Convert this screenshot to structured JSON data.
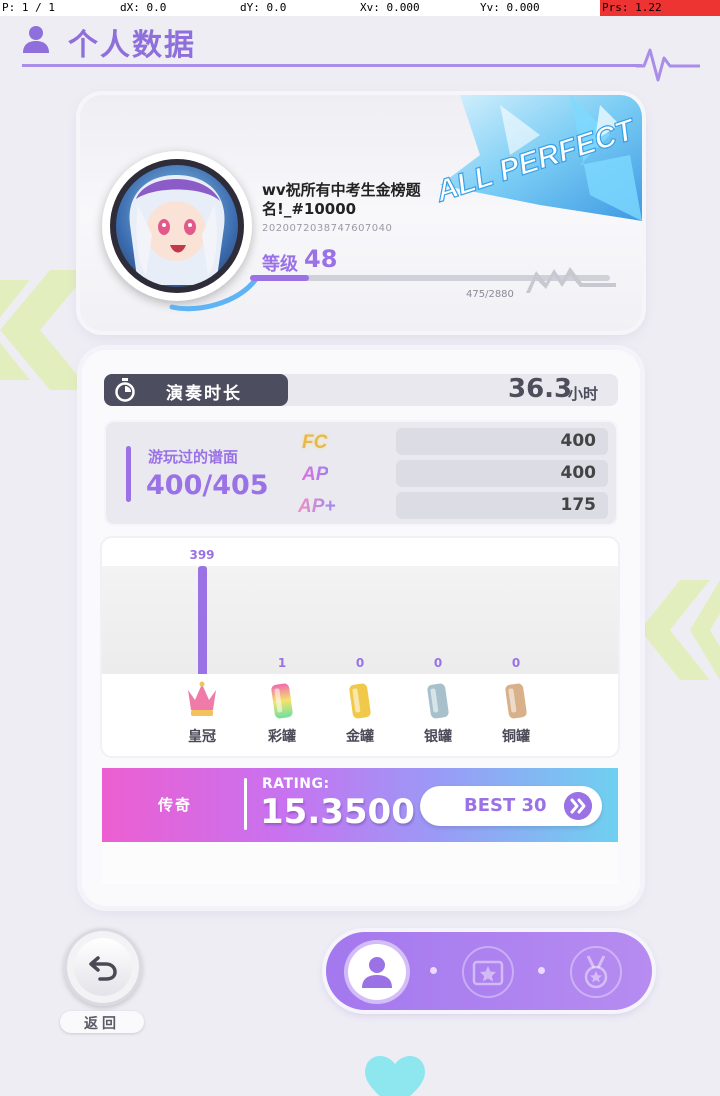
{
  "debug": {
    "p": "P: 1 / 1",
    "dx": "dX: 0.0",
    "dy": "dY: 0.0",
    "xv": "Xv: 0.000",
    "yv": "Yv: 0.000",
    "prs": "Prs: 1.22"
  },
  "header": {
    "title": "个人数据",
    "accent_color": "#8f6fdb"
  },
  "profile": {
    "badge_text": "ALL PERFECT",
    "name": "wv祝所有中考生金榜题名!_#10000",
    "id": "2020072038747607040",
    "level_label": "等级",
    "level_value": "48",
    "xp_text": "475/2880",
    "xp_current": 475,
    "xp_max": 2880
  },
  "stats": {
    "playtime_label": "演奏时长",
    "playtime_value": "36.3",
    "playtime_unit": "小时",
    "charts_label": "游玩过的谱面",
    "charts_value": "400/405",
    "grades": [
      {
        "icon": "FC",
        "count": "400"
      },
      {
        "icon": "AP",
        "count": "400"
      },
      {
        "icon": "AP+",
        "count": "175"
      }
    ],
    "rewards": [
      {
        "label": "皇冠",
        "count": "399",
        "value": 399,
        "icon": "crown-icon",
        "color": "#f07aa8"
      },
      {
        "label": "彩罐",
        "count": "1",
        "value": 1,
        "icon": "rainbow-can-icon",
        "color": "#f06ab0"
      },
      {
        "label": "金罐",
        "count": "0",
        "value": 0,
        "icon": "gold-can-icon",
        "color": "#f0c94a"
      },
      {
        "label": "银罐",
        "count": "0",
        "value": 0,
        "icon": "silver-can-icon",
        "color": "#a8c0cc"
      },
      {
        "label": "铜罐",
        "count": "0",
        "value": 0,
        "icon": "bronze-can-icon",
        "color": "#d8b08a"
      }
    ]
  },
  "rating": {
    "tier": "传奇",
    "caption": "RATING:",
    "value": "15.3500",
    "best_label": "BEST 30"
  },
  "back": {
    "label": "返回"
  }
}
